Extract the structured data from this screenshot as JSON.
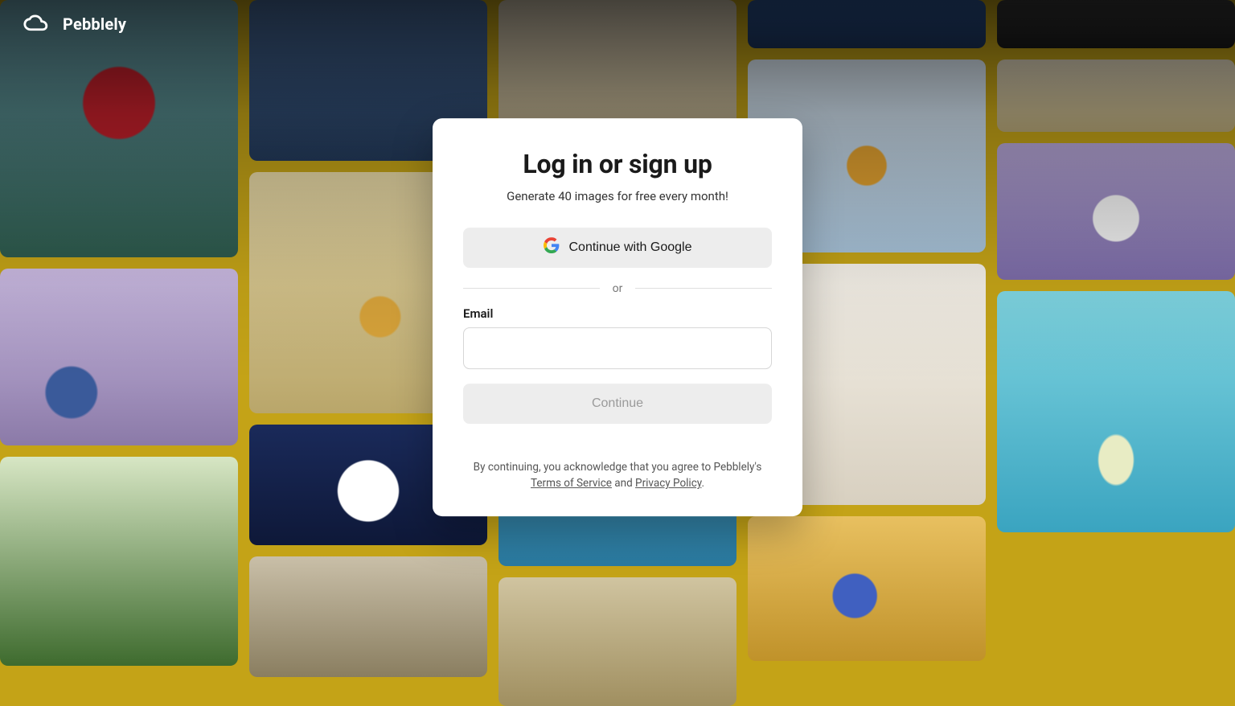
{
  "brand": {
    "name": "Pebblely"
  },
  "auth": {
    "title": "Log in or sign up",
    "subtitle": "Generate 40 images for free every month!",
    "google_label": "Continue with Google",
    "or_label": "or",
    "email_label": "Email",
    "email_value": "",
    "continue_label": "Continue",
    "legal_prefix": "By continuing, you acknowledge that you agree to Pebblely's ",
    "tos_label": "Terms of Service",
    "legal_and": " and ",
    "privacy_label": "Privacy Policy",
    "legal_suffix": "."
  }
}
